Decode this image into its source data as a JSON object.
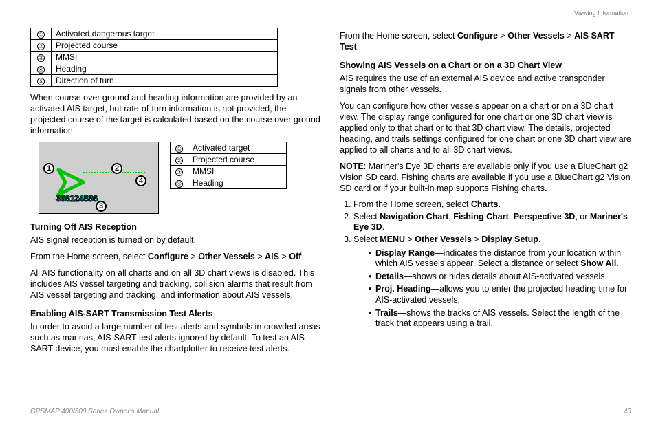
{
  "header": {
    "section": "Viewing Information"
  },
  "footer": {
    "manual": "GPSMAP 400/500 Series Owner's Manual",
    "page": "43"
  },
  "left": {
    "table1": [
      {
        "n": "①",
        "t": "Activated dangerous target"
      },
      {
        "n": "②",
        "t": "Projected course"
      },
      {
        "n": "③",
        "t": "MMSI"
      },
      {
        "n": "④",
        "t": "Heading"
      },
      {
        "n": "⑤",
        "t": "Direction of turn"
      }
    ],
    "p1": "When course over ground and heading information are provided by an activated AIS target, but rate-of-turn information is not provided, the projected course of the target is calculated based on the course over ground information.",
    "fig": {
      "n1": "1",
      "n2": "2",
      "n3": "3",
      "n4": "4",
      "mmsi": "366124586"
    },
    "table2": [
      {
        "n": "①",
        "t": "Activated target"
      },
      {
        "n": "②",
        "t": "Projected course"
      },
      {
        "n": "③",
        "t": "MMSI"
      },
      {
        "n": "④",
        "t": "Heading"
      }
    ],
    "h1": "Turning Off AIS Reception",
    "p2": "AIS signal reception is turned on by default.",
    "p3a": "From the Home screen, select ",
    "p3b": "Configure",
    "p3c": " > ",
    "p3d": "Other Vessels",
    "p3e": " > ",
    "p3f": "AIS",
    "p3g": " > ",
    "p3h": "Off",
    "p3i": ".",
    "p4": "All AIS functionality on all charts and on all 3D chart views is disabled. This includes AIS vessel targeting and tracking, collision alarms that result from AIS vessel targeting and tracking, and information about AIS vessels.",
    "h2": "Enabling AIS-SART Transmission Test Alerts",
    "p5": "In order to avoid a large number of test alerts and symbols in crowded areas such as marinas, AIS-SART test alerts ignored by default. To test an AIS SART device, you must enable the chartplotter to receive test alerts."
  },
  "right": {
    "p0a": "From the Home screen, select ",
    "p0b": "Configure",
    "p0c": " > ",
    "p0d": "Other Vessels",
    "p0e": " > ",
    "p0f": "AIS SART Test",
    "p0g": ".",
    "h1": "Showing AIS Vessels on a Chart or on a 3D Chart View",
    "p1": "AIS requires the use of an external AIS device and active transponder signals from other vessels.",
    "p2": "You can configure how other vessels appear on a chart or on a 3D chart view. The display range configured for one chart or one 3D chart view is applied only to that chart or to that 3D chart view. The details, projected heading, and trails settings configured for one chart or one 3D chart view are applied to all charts and to all 3D chart views.",
    "noteLabel": "NOTE",
    "note": ": Mariner's Eye 3D charts are available only if you use a BlueChart g2 Vision SD card. Fishing charts are available if you use a BlueChart g2 Vision SD card or if your built-in map supports Fishing charts.",
    "s1a": "From the Home screen, select ",
    "s1b": "Charts",
    "s1c": ".",
    "s2a": "Select ",
    "s2b": "Navigation Chart",
    "s2c": ", ",
    "s2d": "Fishing Chart",
    "s2e": ", ",
    "s2f": "Perspective 3D",
    "s2g": ", or ",
    "s2h": "Mariner's Eye 3D",
    "s2i": ".",
    "s3a": "Select ",
    "s3b": "MENU",
    "s3c": " > ",
    "s3d": "Other Vessels",
    "s3e": " > ",
    "s3f": "Display Setup",
    "s3g": ".",
    "b1a": "Display Range",
    "b1b": "—indicates the distance from your location within which AIS vessels appear. Select a distance or select ",
    "b1c": "Show All",
    "b1d": ".",
    "b2a": "Details",
    "b2b": "—shows or hides details about AIS-activated vessels.",
    "b3a": "Proj. Heading",
    "b3b": "—allows you to enter the projected heading time for AIS-activated vessels.",
    "b4a": "Trails",
    "b4b": "—shows the tracks of AIS vessels. Select the length of the track that appears using a trail."
  }
}
